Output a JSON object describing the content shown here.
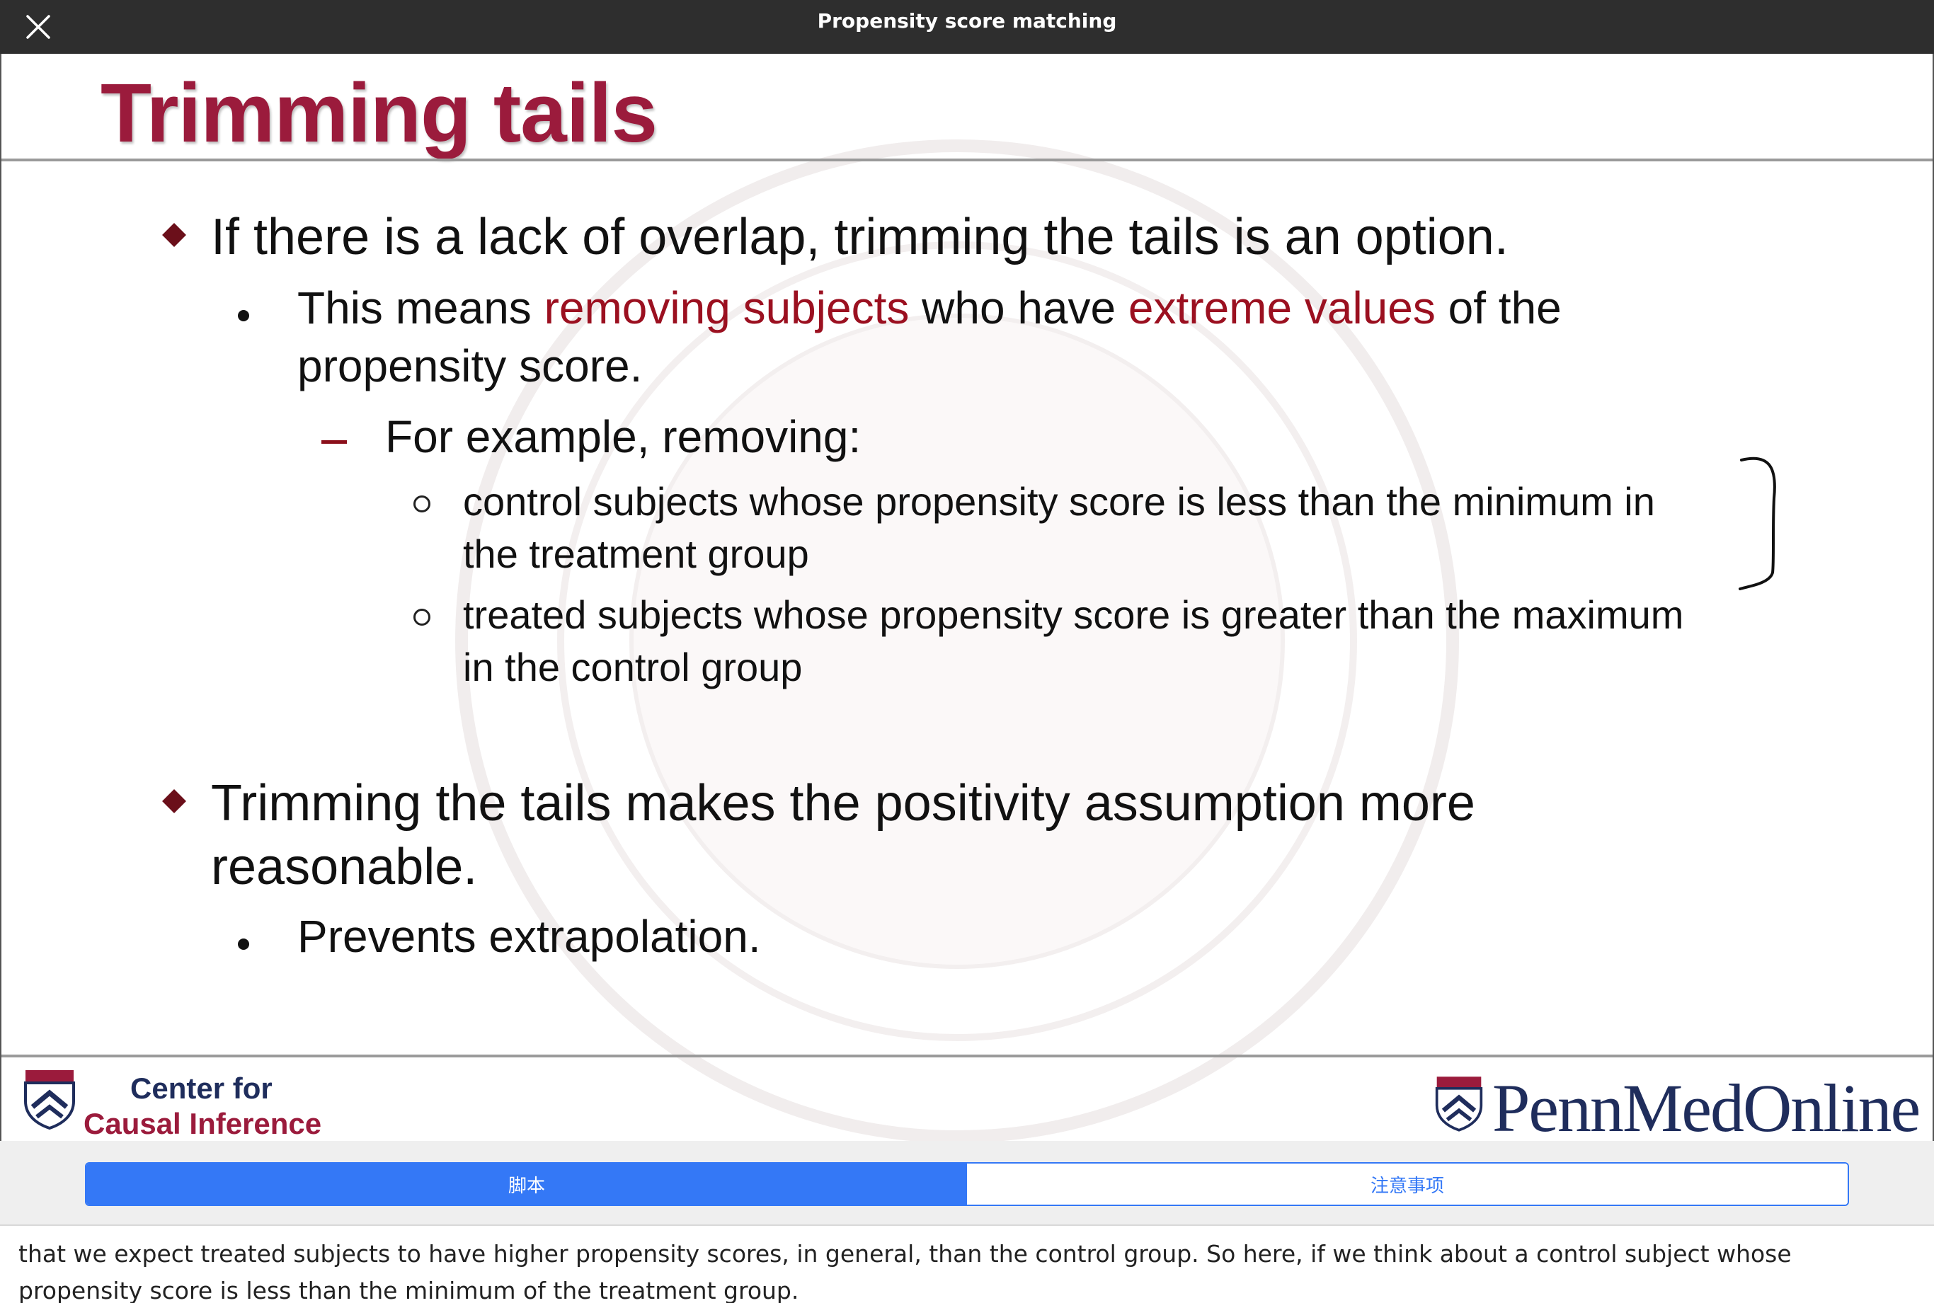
{
  "header": {
    "title": "Propensity score matching",
    "close_icon": "close-icon"
  },
  "slide": {
    "title": "Trimming tails",
    "bullet1": "If there is a lack of overlap, trimming the tails is an option.",
    "sub1": {
      "pre": "This means ",
      "accent1": "removing subjects",
      "mid": " who have ",
      "accent2": "extreme values",
      "post": " of the",
      "line2": "propensity score."
    },
    "example_label": "For example, removing:",
    "items": [
      {
        "line1": "control subjects whose propensity score is less than the minimum in",
        "line2": "the treatment group"
      },
      {
        "line1": "treated subjects whose propensity score is greater than the maximum",
        "line2": "in the control group"
      }
    ],
    "bullet2_line1": "Trimming the tails makes the positivity assumption more",
    "bullet2_line2": "reasonable.",
    "sub2": "Prevents extrapolation.",
    "footer_left": {
      "line1": "Center for",
      "line2": "Causal Inference"
    },
    "footer_right": "PennMedOnline",
    "accent_color": "#9b1b3c"
  },
  "tabs": [
    {
      "label": "脚本",
      "active": true
    },
    {
      "label": "注意事项",
      "active": false
    }
  ],
  "transcript": "that we expect treated subjects to have higher propensity scores, in general, than the control group. So here, if we think about a control subject whose propensity score is less than the minimum of the treatment group."
}
